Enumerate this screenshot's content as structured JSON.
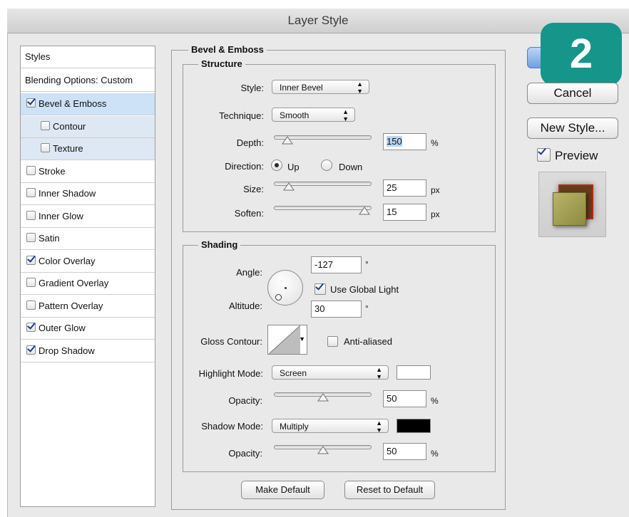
{
  "window": {
    "title": "Layer Style"
  },
  "badge": {
    "text": "2",
    "color": "#16958a"
  },
  "styles_list": {
    "header": "Styles",
    "blending": "Blending Options: Custom",
    "items": [
      {
        "label": "Bevel & Emboss",
        "checked": true
      },
      {
        "label": "Contour",
        "checked": false
      },
      {
        "label": "Texture",
        "checked": false
      },
      {
        "label": "Stroke",
        "checked": false
      },
      {
        "label": "Inner Shadow",
        "checked": false
      },
      {
        "label": "Inner Glow",
        "checked": false
      },
      {
        "label": "Satin",
        "checked": false
      },
      {
        "label": "Color Overlay",
        "checked": true
      },
      {
        "label": "Gradient Overlay",
        "checked": false
      },
      {
        "label": "Pattern Overlay",
        "checked": false
      },
      {
        "label": "Outer Glow",
        "checked": true
      },
      {
        "label": "Drop Shadow",
        "checked": true
      }
    ]
  },
  "bevel": {
    "title": "Bevel & Emboss",
    "structure": {
      "title": "Structure",
      "style_label": "Style:",
      "style_value": "Inner Bevel",
      "technique_label": "Technique:",
      "technique_value": "Smooth",
      "depth_label": "Depth:",
      "depth_value": "150",
      "depth_unit": "%",
      "depth_slider": 0.1,
      "direction_label": "Direction:",
      "dir_up": "Up",
      "dir_down": "Down",
      "size_label": "Size:",
      "size_value": "25",
      "size_unit": "px",
      "size_slider": 0.12,
      "soften_label": "Soften:",
      "soften_value": "15",
      "soften_unit": "px",
      "soften_slider": 0.97
    },
    "shading": {
      "title": "Shading",
      "angle_label": "Angle:",
      "angle_value": "-127",
      "deg": "°",
      "use_global_light": "Use Global Light",
      "altitude_label": "Altitude:",
      "altitude_value": "30",
      "gloss_label": "Gloss Contour:",
      "anti_aliased": "Anti-aliased",
      "highlight_label": "Highlight Mode:",
      "highlight_value": "Screen",
      "highlight_color": "#ffffff",
      "hl_opacity_label": "Opacity:",
      "hl_opacity_value": "50",
      "pct": "%",
      "hl_opacity_slider": 0.5,
      "shadow_label": "Shadow Mode:",
      "shadow_value": "Multiply",
      "shadow_color": "#000000",
      "sh_opacity_label": "Opacity:",
      "sh_opacity_value": "50",
      "sh_opacity_slider": 0.5
    },
    "make_default": "Make Default",
    "reset_default": "Reset to Default"
  },
  "buttons": {
    "cancel": "Cancel",
    "new_style": "New Style...",
    "preview": "Preview"
  }
}
